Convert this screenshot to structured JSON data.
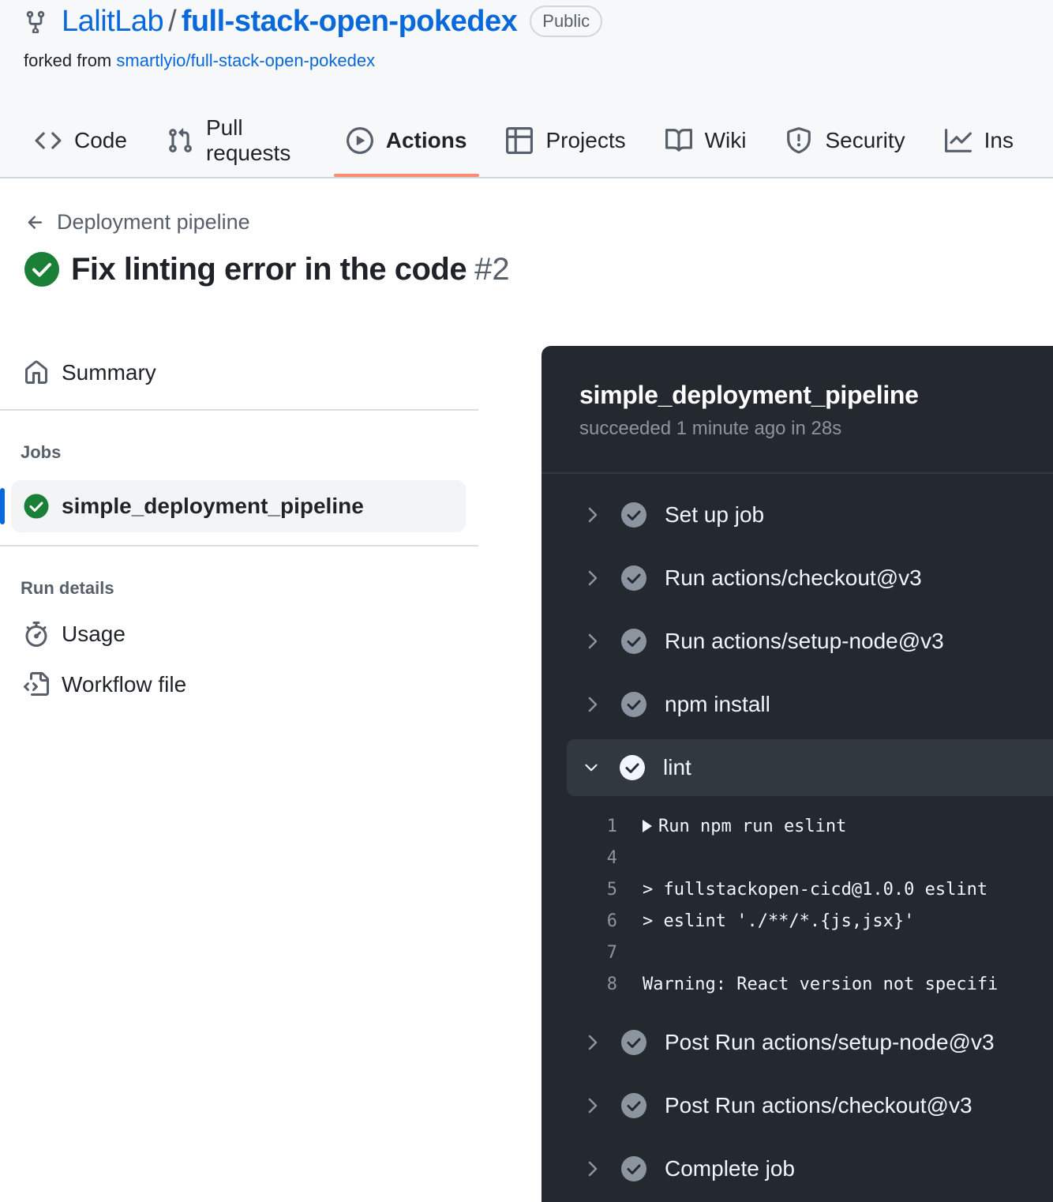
{
  "repo": {
    "owner": "LalitLab",
    "separator": "/",
    "name": "full-stack-open-pokedex",
    "visibility": "Public",
    "forked_prefix": "forked from",
    "forked_source": "smartlyio/full-stack-open-pokedex"
  },
  "tabs": [
    {
      "label": "Code",
      "icon": "code-icon"
    },
    {
      "label": "Pull requests",
      "icon": "pull-request-icon"
    },
    {
      "label": "Actions",
      "icon": "play-icon",
      "active": true
    },
    {
      "label": "Projects",
      "icon": "table-icon"
    },
    {
      "label": "Wiki",
      "icon": "book-icon"
    },
    {
      "label": "Security",
      "icon": "shield-icon"
    },
    {
      "label": "Ins",
      "icon": "graph-icon"
    }
  ],
  "run": {
    "workflow": "Deployment pipeline",
    "title": "Fix linting error in the code",
    "number": "#2"
  },
  "sidebar": {
    "summary": "Summary",
    "jobs_heading": "Jobs",
    "job": "simple_deployment_pipeline",
    "details_heading": "Run details",
    "usage": "Usage",
    "workflow_file": "Workflow file"
  },
  "job_log": {
    "name": "simple_deployment_pipeline",
    "status": "succeeded 1 minute ago in 28s",
    "steps_before": [
      "Set up job",
      "Run actions/checkout@v3",
      "Run actions/setup-node@v3",
      "npm install"
    ],
    "expanded_step": "lint",
    "lines": [
      {
        "n": "1",
        "t": "Run npm run eslint",
        "collapsible": true
      },
      {
        "n": "4",
        "t": ""
      },
      {
        "n": "5",
        "t": "> fullstackopen-cicd@1.0.0 eslint"
      },
      {
        "n": "6",
        "t": "> eslint './**/*.{js,jsx}'"
      },
      {
        "n": "7",
        "t": ""
      },
      {
        "n": "8",
        "t": "Warning: React version not specifi"
      }
    ],
    "steps_after": [
      "Post Run actions/setup-node@v3",
      "Post Run actions/checkout@v3",
      "Complete job"
    ]
  },
  "colors": {
    "link": "#0969da",
    "success": "#1a7f37",
    "active_tab_underline": "#fd8c73",
    "log_bg": "#24292f"
  }
}
